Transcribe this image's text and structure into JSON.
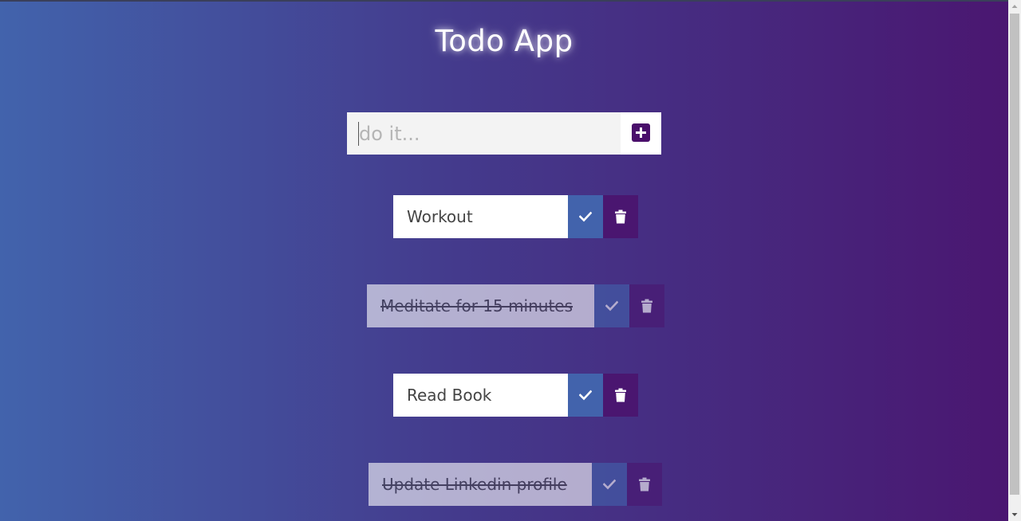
{
  "app": {
    "title": "Todo App"
  },
  "input": {
    "placeholder": "do it...",
    "value": ""
  },
  "add_button": {
    "icon": "plus-square-icon"
  },
  "todos": [
    {
      "text": "Workout",
      "completed": false
    },
    {
      "text": "Meditate for 15 minutes",
      "completed": true
    },
    {
      "text": "Read Book",
      "completed": false
    },
    {
      "text": "Update Linkedin profile",
      "completed": true
    }
  ],
  "icons": {
    "check": "check-icon",
    "trash": "trash-icon"
  },
  "colors": {
    "gradient_start": "#4263ac",
    "gradient_end": "#4a1670",
    "check_button": "#4263ac",
    "trash_button": "#4a1670",
    "add_button": "#4a0f6b"
  }
}
